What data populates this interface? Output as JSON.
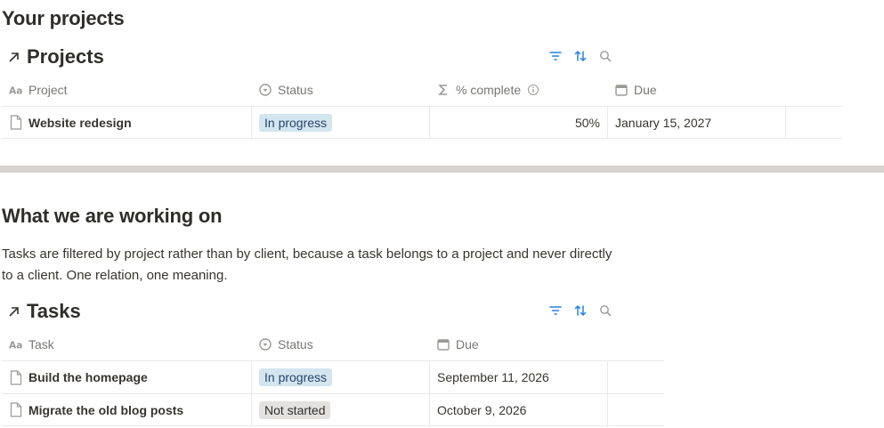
{
  "section1": {
    "heading": "Your projects"
  },
  "projects_db": {
    "title": "Projects",
    "columns": [
      {
        "label": "Project",
        "icon": "text-aa-icon"
      },
      {
        "label": "Status",
        "icon": "status-circle-icon"
      },
      {
        "label": "% complete",
        "icon": "sigma-icon",
        "info_icon": "info-icon"
      },
      {
        "label": "Due",
        "icon": "calendar-icon"
      }
    ],
    "rows": [
      {
        "name": "Website redesign",
        "status": "In progress",
        "status_color": "#d3e5ef",
        "percent": "50%",
        "due": "January 15, 2027"
      }
    ]
  },
  "section2": {
    "heading": "What we are working on",
    "description": "Tasks are filtered by project rather than by client, because a task belongs to a project and never directly to a client. One relation, one meaning."
  },
  "tasks_db": {
    "title": "Tasks",
    "columns": [
      {
        "label": "Task",
        "icon": "text-aa-icon"
      },
      {
        "label": "Status",
        "icon": "status-circle-icon"
      },
      {
        "label": "Due",
        "icon": "calendar-icon"
      }
    ],
    "rows": [
      {
        "name": "Build the homepage",
        "status": "In progress",
        "status_color": "#d3e5ef",
        "due": "September 11, 2026"
      },
      {
        "name": "Migrate the old blog posts",
        "status": "Not started",
        "status_color": "#e3e2e0",
        "due": "October 9, 2026"
      }
    ]
  },
  "colors": {
    "accent": "#2383e2",
    "divider": "#d6d5cf",
    "text": "#37352f"
  }
}
